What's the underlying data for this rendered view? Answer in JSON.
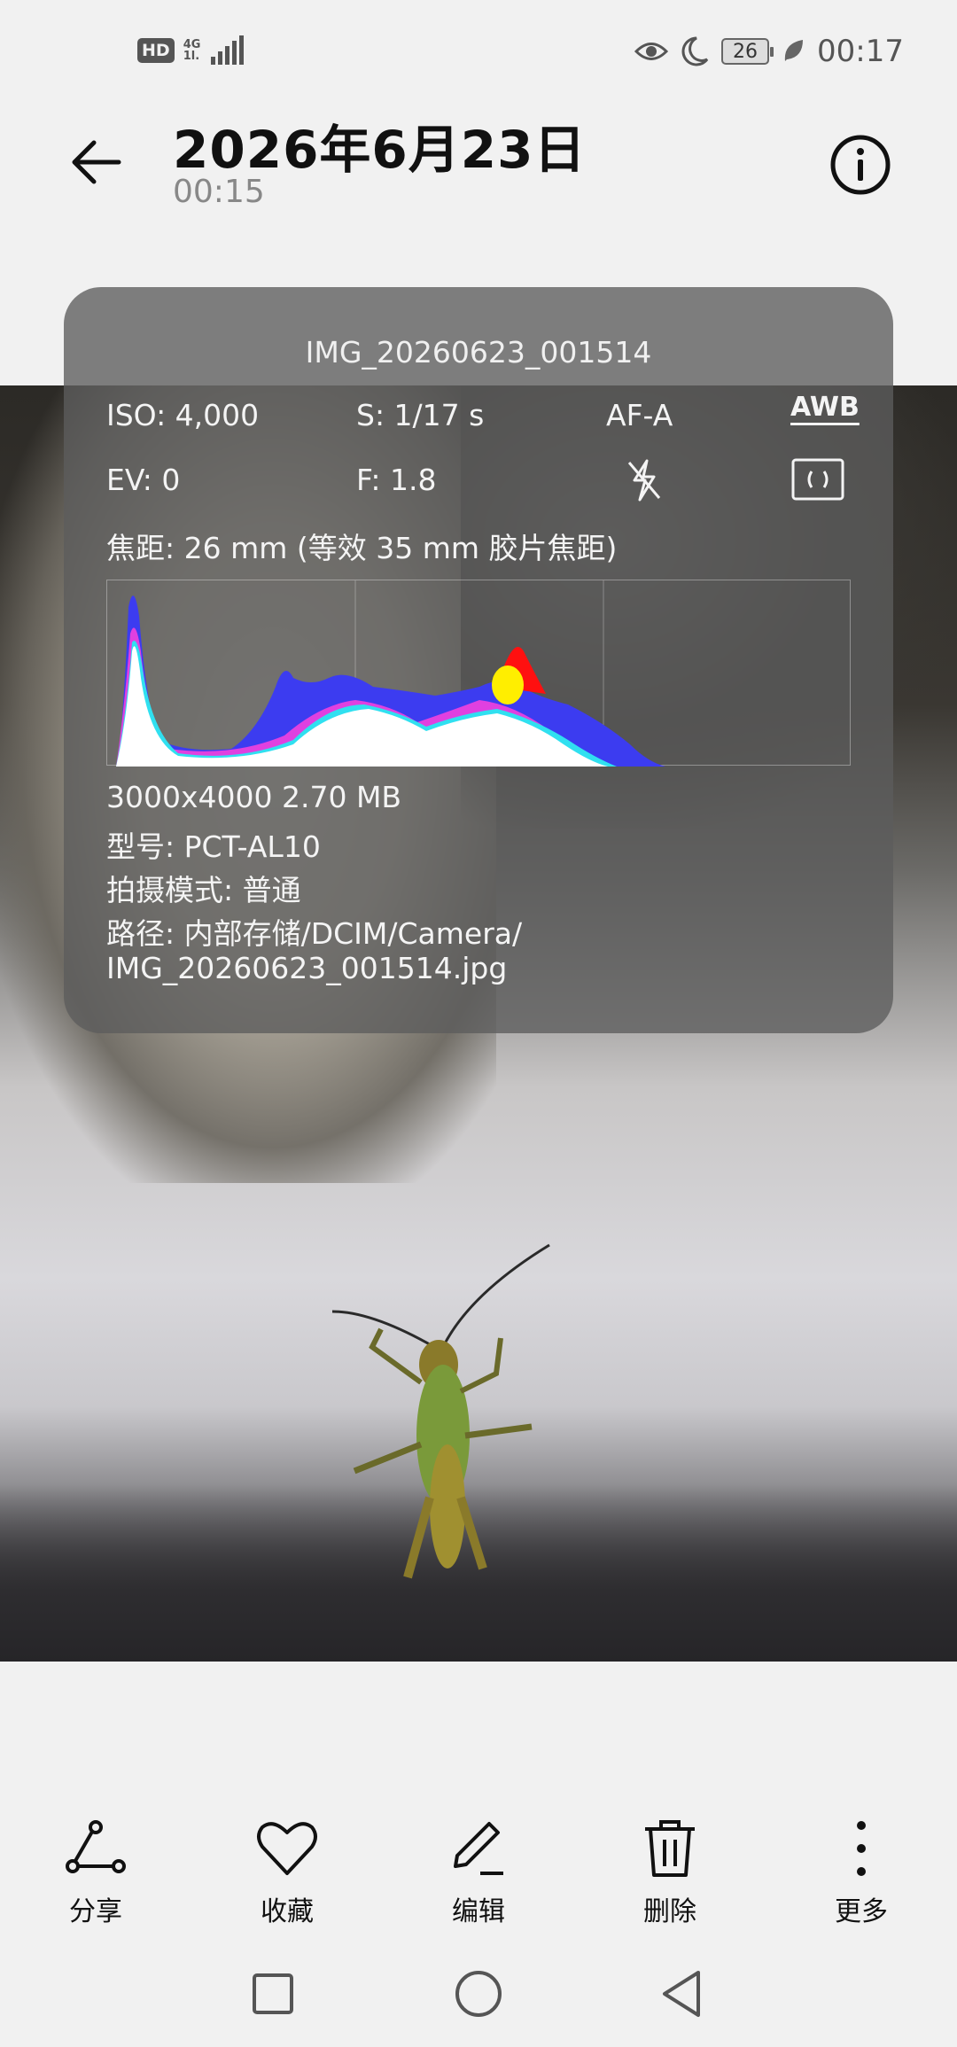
{
  "status_bar": {
    "hd": "HD",
    "network": "4G",
    "network_sub": "1l.",
    "battery": "26",
    "time": "00:17"
  },
  "header": {
    "title": "2026年6月23日",
    "subtitle": "00:15"
  },
  "info_panel": {
    "filename": "IMG_20260623_001514",
    "iso": "ISO: 4,000",
    "shutter": "S: 1/17 s",
    "af_mode": "AF-A",
    "wb": "AWB",
    "ev": "EV: 0",
    "aperture": "F: 1.8",
    "focal_length": "焦距: 26 mm (等效 35 mm 胶片焦距)",
    "resolution_size": "3000x4000  2.70 MB",
    "model": "型号:  PCT-AL10",
    "shooting_mode": "拍摄模式:  普通",
    "path_line1": "路径:  内部存储/DCIM/Camera/",
    "path_line2": "IMG_20260623_001514.jpg"
  },
  "toolbar": {
    "share": "分享",
    "favorite": "收藏",
    "edit": "编辑",
    "delete": "删除",
    "more": "更多"
  },
  "icons": {
    "back": "arrow-left-icon",
    "info": "info-icon",
    "flash_off": "flash-off-icon",
    "metering": "metering-icon"
  },
  "colors": {
    "panel": "#5c5c5c",
    "background": "#f1f1f1"
  }
}
